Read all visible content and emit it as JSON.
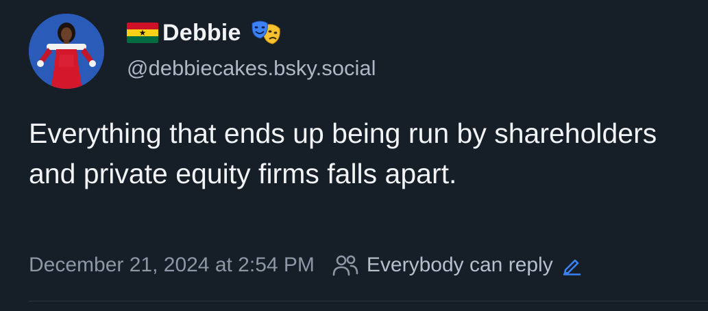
{
  "author": {
    "display_name": "Debbie",
    "handle": "@debbiecakes.bsky.social",
    "flag": "ghana-flag",
    "name_emoji": "performing-arts-masks-icon",
    "avatar": "user-avatar-red-dress"
  },
  "post": {
    "text": "Everything that ends up being run by shareholders and private equity firms falls apart."
  },
  "meta": {
    "timestamp": "December 21, 2024 at 2:54 PM",
    "reply_setting": "Everybody can reply",
    "reply_icon": "people-icon",
    "edit_icon": "pencil-icon"
  },
  "colors": {
    "background": "#161e27",
    "primary_text": "#f1f3f5",
    "secondary_text": "#aeb8c4",
    "accent": "#3b82f6",
    "ghana_red": "#ce1126",
    "ghana_gold": "#fcd116",
    "ghana_green": "#006b3f"
  }
}
